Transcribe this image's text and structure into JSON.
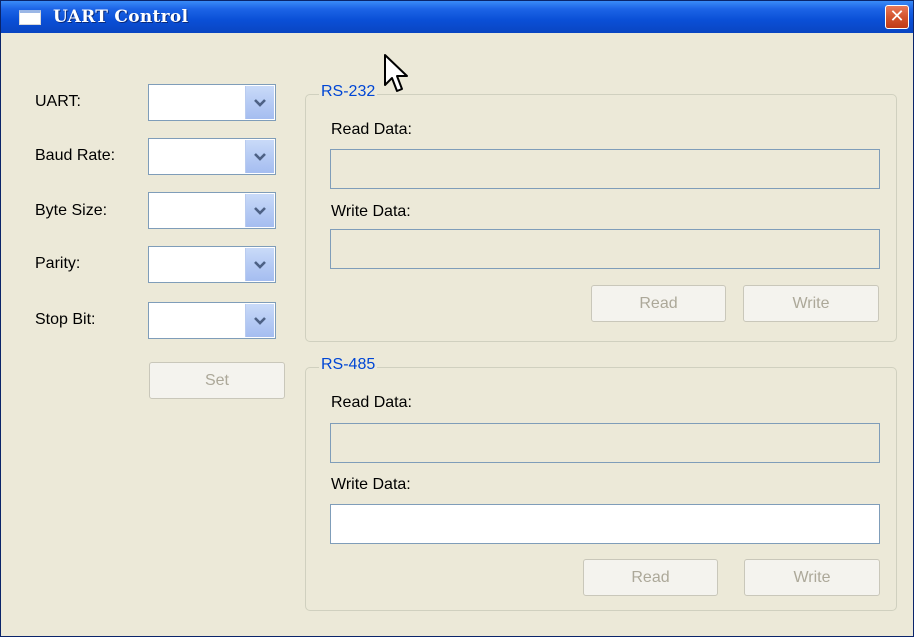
{
  "window": {
    "title": "UART Control"
  },
  "settings": {
    "fields": [
      {
        "label": "UART:",
        "value": ""
      },
      {
        "label": "Baud Rate:",
        "value": ""
      },
      {
        "label": "Byte Size:",
        "value": ""
      },
      {
        "label": "Parity:",
        "value": ""
      },
      {
        "label": "Stop Bit:",
        "value": ""
      }
    ],
    "set_label": "Set"
  },
  "rs232": {
    "title": "RS-232",
    "read_label": "Read Data:",
    "read_value": "",
    "write_label": "Write Data:",
    "write_value": "",
    "read_button": "Read",
    "write_button": "Write"
  },
  "rs485": {
    "title": "RS-485",
    "read_label": "Read Data:",
    "read_value": "",
    "write_label": "Write Data:",
    "write_value": "",
    "read_button": "Read",
    "write_button": "Write"
  },
  "icons": {
    "window_icon": "window-icon",
    "close": "close-icon",
    "dropdown": "chevron-down-icon",
    "cursor": "mouse-pointer-icon"
  },
  "colors": {
    "titlebar": "#0a4fd6",
    "window_bg": "#ece9d8",
    "group_title": "#0046d5",
    "close": "#d3542e"
  }
}
